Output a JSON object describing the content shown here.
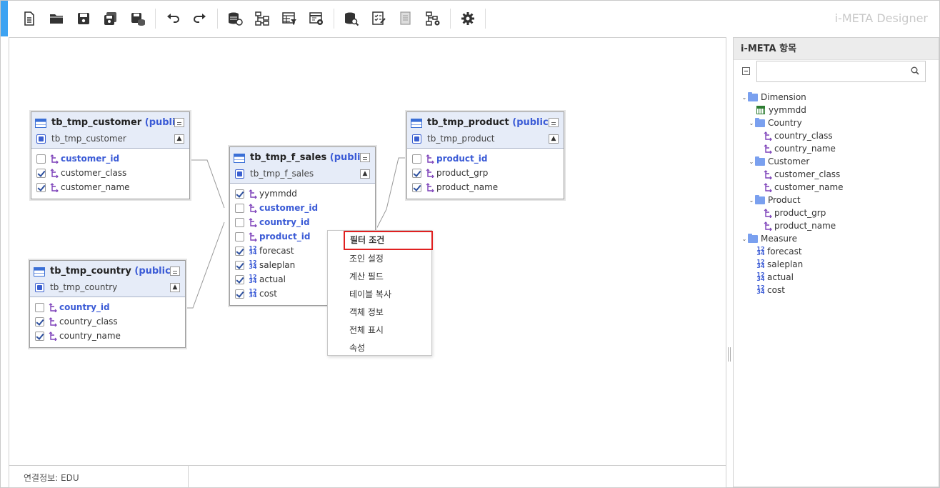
{
  "app": {
    "brand": "i-META Designer"
  },
  "toolbar": {
    "buttons": [
      "new-doc",
      "open-folder",
      "save",
      "save-all",
      "save-db",
      "undo",
      "redo",
      "db-link",
      "tree-structure",
      "table-filter",
      "table-settings",
      "db-search",
      "checklist",
      "document",
      "tree-settings",
      "settings"
    ]
  },
  "tables": {
    "customer": {
      "title": "tb_tmp_customer",
      "schema": "(public)",
      "alias": "tb_tmp_customer",
      "fields": [
        {
          "name": "customer_id",
          "checked": false,
          "key": true
        },
        {
          "name": "customer_class",
          "checked": true,
          "key": false
        },
        {
          "name": "customer_name",
          "checked": true,
          "key": false
        }
      ]
    },
    "country": {
      "title": "tb_tmp_country",
      "schema": "(public)",
      "alias": "tb_tmp_country",
      "fields": [
        {
          "name": "country_id",
          "checked": false,
          "key": true
        },
        {
          "name": "country_class",
          "checked": true,
          "key": false
        },
        {
          "name": "country_name",
          "checked": true,
          "key": false
        }
      ]
    },
    "sales": {
      "title": "tb_tmp_f_sales",
      "schema": "(public)",
      "alias": "tb_tmp_f_sales",
      "fields": [
        {
          "name": "yymmdd",
          "checked": true,
          "key": false,
          "type": "dim"
        },
        {
          "name": "customer_id",
          "checked": false,
          "key": true,
          "type": "dim"
        },
        {
          "name": "country_id",
          "checked": false,
          "key": true,
          "type": "dim"
        },
        {
          "name": "product_id",
          "checked": false,
          "key": true,
          "type": "dim"
        },
        {
          "name": "forecast",
          "checked": true,
          "key": false,
          "type": "num"
        },
        {
          "name": "saleplan",
          "checked": true,
          "key": false,
          "type": "num"
        },
        {
          "name": "actual",
          "checked": true,
          "key": false,
          "type": "num"
        },
        {
          "name": "cost",
          "checked": true,
          "key": false,
          "type": "num"
        }
      ]
    },
    "product": {
      "title": "tb_tmp_product",
      "schema": "(public)",
      "alias": "tb_tmp_product",
      "fields": [
        {
          "name": "product_id",
          "checked": false,
          "key": true
        },
        {
          "name": "product_grp",
          "checked": true,
          "key": false
        },
        {
          "name": "product_name",
          "checked": true,
          "key": false
        }
      ]
    }
  },
  "context_menu": {
    "items": [
      "필터 조건",
      "조인 설정",
      "계산 필드",
      "테이블 복사",
      "객체 정보",
      "전체 표시",
      "속성"
    ]
  },
  "status": {
    "connection": "연결정보: EDU"
  },
  "panel": {
    "title": "i-META 항목",
    "search_placeholder": "",
    "tree": {
      "dimension": "Dimension",
      "yymmdd": "yymmdd",
      "country": "Country",
      "country_class": "country_class",
      "country_name": "country_name",
      "customer": "Customer",
      "customer_class": "customer_class",
      "customer_name": "customer_name",
      "product": "Product",
      "product_grp": "product_grp",
      "product_name": "product_name",
      "measure": "Measure",
      "forecast": "forecast",
      "saleplan": "saleplan",
      "actual": "actual",
      "cost": "cost"
    }
  },
  "colors": {
    "accent": "#3da3f2",
    "key_field": "#3b5bd6",
    "highlight": "#e02020"
  }
}
